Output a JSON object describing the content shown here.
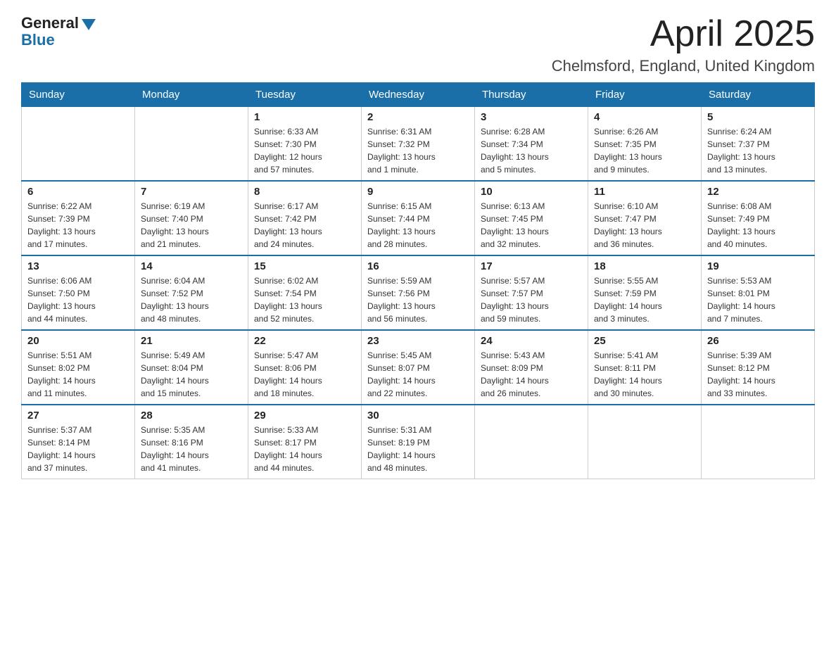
{
  "header": {
    "logo_general": "General",
    "logo_blue": "Blue",
    "month_title": "April 2025",
    "location": "Chelmsford, England, United Kingdom"
  },
  "weekdays": [
    "Sunday",
    "Monday",
    "Tuesday",
    "Wednesday",
    "Thursday",
    "Friday",
    "Saturday"
  ],
  "weeks": [
    [
      {
        "day": "",
        "info": ""
      },
      {
        "day": "",
        "info": ""
      },
      {
        "day": "1",
        "info": "Sunrise: 6:33 AM\nSunset: 7:30 PM\nDaylight: 12 hours\nand 57 minutes."
      },
      {
        "day": "2",
        "info": "Sunrise: 6:31 AM\nSunset: 7:32 PM\nDaylight: 13 hours\nand 1 minute."
      },
      {
        "day": "3",
        "info": "Sunrise: 6:28 AM\nSunset: 7:34 PM\nDaylight: 13 hours\nand 5 minutes."
      },
      {
        "day": "4",
        "info": "Sunrise: 6:26 AM\nSunset: 7:35 PM\nDaylight: 13 hours\nand 9 minutes."
      },
      {
        "day": "5",
        "info": "Sunrise: 6:24 AM\nSunset: 7:37 PM\nDaylight: 13 hours\nand 13 minutes."
      }
    ],
    [
      {
        "day": "6",
        "info": "Sunrise: 6:22 AM\nSunset: 7:39 PM\nDaylight: 13 hours\nand 17 minutes."
      },
      {
        "day": "7",
        "info": "Sunrise: 6:19 AM\nSunset: 7:40 PM\nDaylight: 13 hours\nand 21 minutes."
      },
      {
        "day": "8",
        "info": "Sunrise: 6:17 AM\nSunset: 7:42 PM\nDaylight: 13 hours\nand 24 minutes."
      },
      {
        "day": "9",
        "info": "Sunrise: 6:15 AM\nSunset: 7:44 PM\nDaylight: 13 hours\nand 28 minutes."
      },
      {
        "day": "10",
        "info": "Sunrise: 6:13 AM\nSunset: 7:45 PM\nDaylight: 13 hours\nand 32 minutes."
      },
      {
        "day": "11",
        "info": "Sunrise: 6:10 AM\nSunset: 7:47 PM\nDaylight: 13 hours\nand 36 minutes."
      },
      {
        "day": "12",
        "info": "Sunrise: 6:08 AM\nSunset: 7:49 PM\nDaylight: 13 hours\nand 40 minutes."
      }
    ],
    [
      {
        "day": "13",
        "info": "Sunrise: 6:06 AM\nSunset: 7:50 PM\nDaylight: 13 hours\nand 44 minutes."
      },
      {
        "day": "14",
        "info": "Sunrise: 6:04 AM\nSunset: 7:52 PM\nDaylight: 13 hours\nand 48 minutes."
      },
      {
        "day": "15",
        "info": "Sunrise: 6:02 AM\nSunset: 7:54 PM\nDaylight: 13 hours\nand 52 minutes."
      },
      {
        "day": "16",
        "info": "Sunrise: 5:59 AM\nSunset: 7:56 PM\nDaylight: 13 hours\nand 56 minutes."
      },
      {
        "day": "17",
        "info": "Sunrise: 5:57 AM\nSunset: 7:57 PM\nDaylight: 13 hours\nand 59 minutes."
      },
      {
        "day": "18",
        "info": "Sunrise: 5:55 AM\nSunset: 7:59 PM\nDaylight: 14 hours\nand 3 minutes."
      },
      {
        "day": "19",
        "info": "Sunrise: 5:53 AM\nSunset: 8:01 PM\nDaylight: 14 hours\nand 7 minutes."
      }
    ],
    [
      {
        "day": "20",
        "info": "Sunrise: 5:51 AM\nSunset: 8:02 PM\nDaylight: 14 hours\nand 11 minutes."
      },
      {
        "day": "21",
        "info": "Sunrise: 5:49 AM\nSunset: 8:04 PM\nDaylight: 14 hours\nand 15 minutes."
      },
      {
        "day": "22",
        "info": "Sunrise: 5:47 AM\nSunset: 8:06 PM\nDaylight: 14 hours\nand 18 minutes."
      },
      {
        "day": "23",
        "info": "Sunrise: 5:45 AM\nSunset: 8:07 PM\nDaylight: 14 hours\nand 22 minutes."
      },
      {
        "day": "24",
        "info": "Sunrise: 5:43 AM\nSunset: 8:09 PM\nDaylight: 14 hours\nand 26 minutes."
      },
      {
        "day": "25",
        "info": "Sunrise: 5:41 AM\nSunset: 8:11 PM\nDaylight: 14 hours\nand 30 minutes."
      },
      {
        "day": "26",
        "info": "Sunrise: 5:39 AM\nSunset: 8:12 PM\nDaylight: 14 hours\nand 33 minutes."
      }
    ],
    [
      {
        "day": "27",
        "info": "Sunrise: 5:37 AM\nSunset: 8:14 PM\nDaylight: 14 hours\nand 37 minutes."
      },
      {
        "day": "28",
        "info": "Sunrise: 5:35 AM\nSunset: 8:16 PM\nDaylight: 14 hours\nand 41 minutes."
      },
      {
        "day": "29",
        "info": "Sunrise: 5:33 AM\nSunset: 8:17 PM\nDaylight: 14 hours\nand 44 minutes."
      },
      {
        "day": "30",
        "info": "Sunrise: 5:31 AM\nSunset: 8:19 PM\nDaylight: 14 hours\nand 48 minutes."
      },
      {
        "day": "",
        "info": ""
      },
      {
        "day": "",
        "info": ""
      },
      {
        "day": "",
        "info": ""
      }
    ]
  ]
}
